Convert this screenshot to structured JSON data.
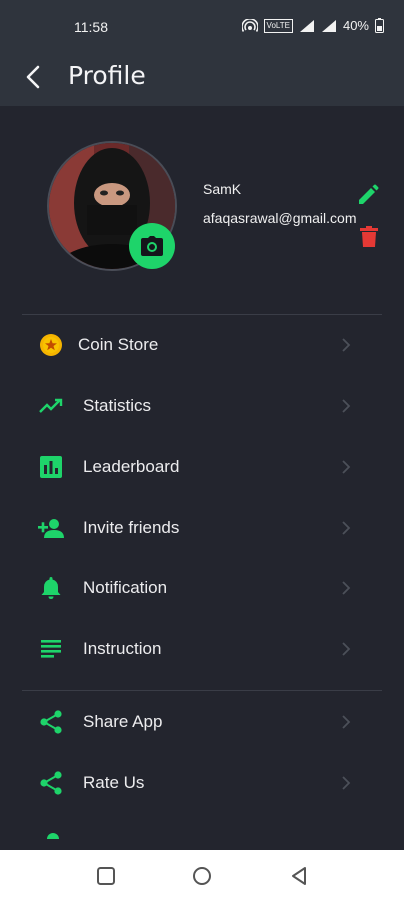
{
  "status": {
    "time": "11:58",
    "battery": "40%",
    "network": "VoLTE"
  },
  "header": {
    "title": "Profile"
  },
  "profile": {
    "name": "SamK",
    "email": "afaqasrawal@gmail.com"
  },
  "colors": {
    "accent": "#1ed46a",
    "delete": "#e53935",
    "coin": "#f5b400",
    "background": "#23252e",
    "appbar": "#2f343d"
  },
  "menu_primary": [
    {
      "label": "Coin Store",
      "icon": "coin-icon"
    },
    {
      "label": "Statistics",
      "icon": "trending-up-icon"
    },
    {
      "label": "Leaderboard",
      "icon": "leaderboard-icon"
    },
    {
      "label": "Invite friends",
      "icon": "add-person-icon"
    },
    {
      "label": "Notification",
      "icon": "bell-icon"
    },
    {
      "label": "Instruction",
      "icon": "notes-icon"
    }
  ],
  "menu_secondary": [
    {
      "label": "Share App",
      "icon": "share-icon"
    },
    {
      "label": "Rate Us",
      "icon": "share-icon"
    }
  ]
}
